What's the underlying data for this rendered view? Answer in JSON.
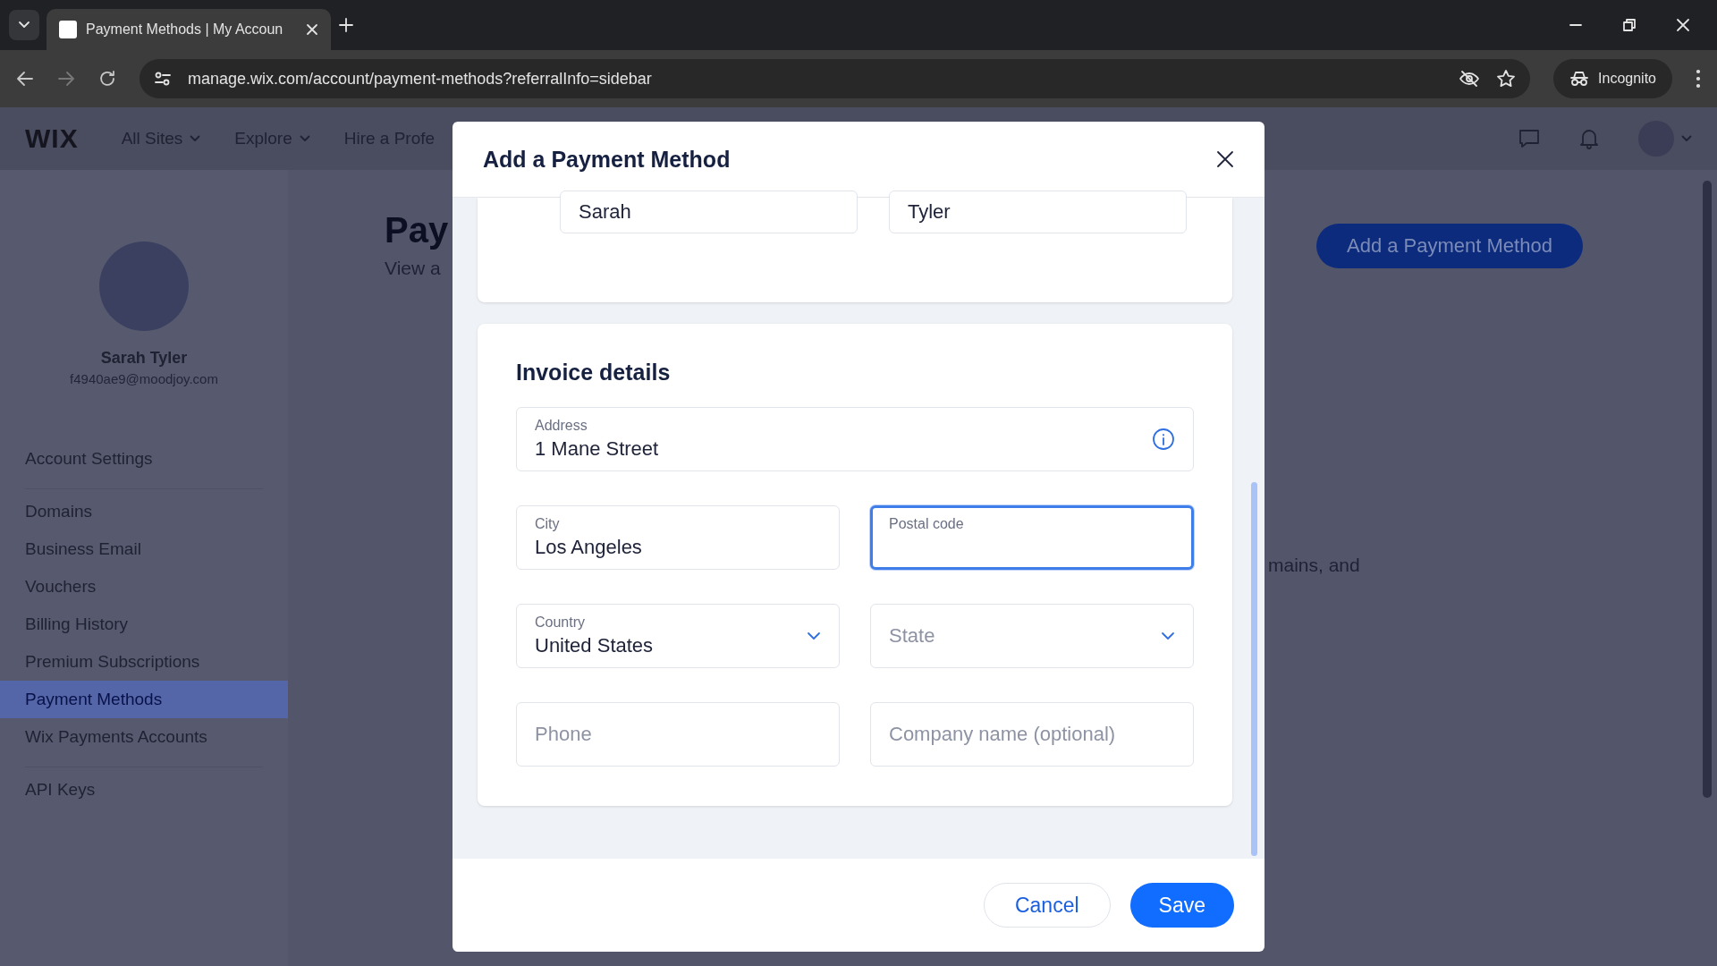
{
  "browser": {
    "tabs": [
      {
        "title": "Payment Methods | My Accoun",
        "selected": true
      }
    ],
    "url": "manage.wix.com/account/payment-methods?referralInfo=sidebar",
    "profile_label": "Incognito"
  },
  "site_header": {
    "logo": "WIX",
    "nav": [
      {
        "label": "All Sites",
        "dropdown": true
      },
      {
        "label": "Explore",
        "dropdown": true
      },
      {
        "label": "Hire a Profe",
        "dropdown": false
      }
    ]
  },
  "sidebar": {
    "user_name": "Sarah Tyler",
    "user_email": "f4940ae9@moodjoy.com",
    "groups": [
      [
        {
          "label": "Account Settings",
          "selected": false
        }
      ],
      [
        {
          "label": "Domains",
          "selected": false
        },
        {
          "label": "Business Email",
          "selected": false
        },
        {
          "label": "Vouchers",
          "selected": false
        },
        {
          "label": "Billing History",
          "selected": false
        },
        {
          "label": "Premium Subscriptions",
          "selected": false
        },
        {
          "label": "Payment Methods",
          "selected": true
        },
        {
          "label": "Wix Payments Accounts",
          "selected": false
        }
      ],
      [
        {
          "label": "API Keys",
          "selected": false
        }
      ]
    ]
  },
  "page": {
    "title": "Pay",
    "subtitle": "View a",
    "primary_button": "Add a Payment Method",
    "body_fragment": "mains, and"
  },
  "dialog": {
    "title": "Add a Payment Method",
    "name_fields": [
      {
        "value": "Sarah"
      },
      {
        "value": "Tyler"
      }
    ],
    "section_title": "Invoice details",
    "fields": [
      {
        "kind": "text",
        "label": "Address",
        "value": "1 Mane Street",
        "focused": false,
        "info": true,
        "wide": true
      },
      {
        "kind": "text",
        "label": "City",
        "value": "Los Angeles",
        "focused": false,
        "info": false,
        "wide": false
      },
      {
        "kind": "text",
        "label": "Postal code",
        "focused": true,
        "info": false,
        "wide": false
      },
      {
        "kind": "select",
        "label": "Country",
        "value": "United States",
        "focused": false,
        "info": false,
        "wide": false
      },
      {
        "kind": "select",
        "placeholder": "State",
        "focused": false,
        "info": false,
        "wide": false
      },
      {
        "kind": "text",
        "placeholder": "Phone",
        "focused": false,
        "info": false,
        "wide": false
      },
      {
        "kind": "text",
        "placeholder": "Company name (optional)",
        "focused": false,
        "info": false,
        "wide": false
      }
    ],
    "buttons": [
      {
        "label": "Cancel",
        "kind": "secondary"
      },
      {
        "label": "Save",
        "kind": "primary"
      }
    ]
  }
}
